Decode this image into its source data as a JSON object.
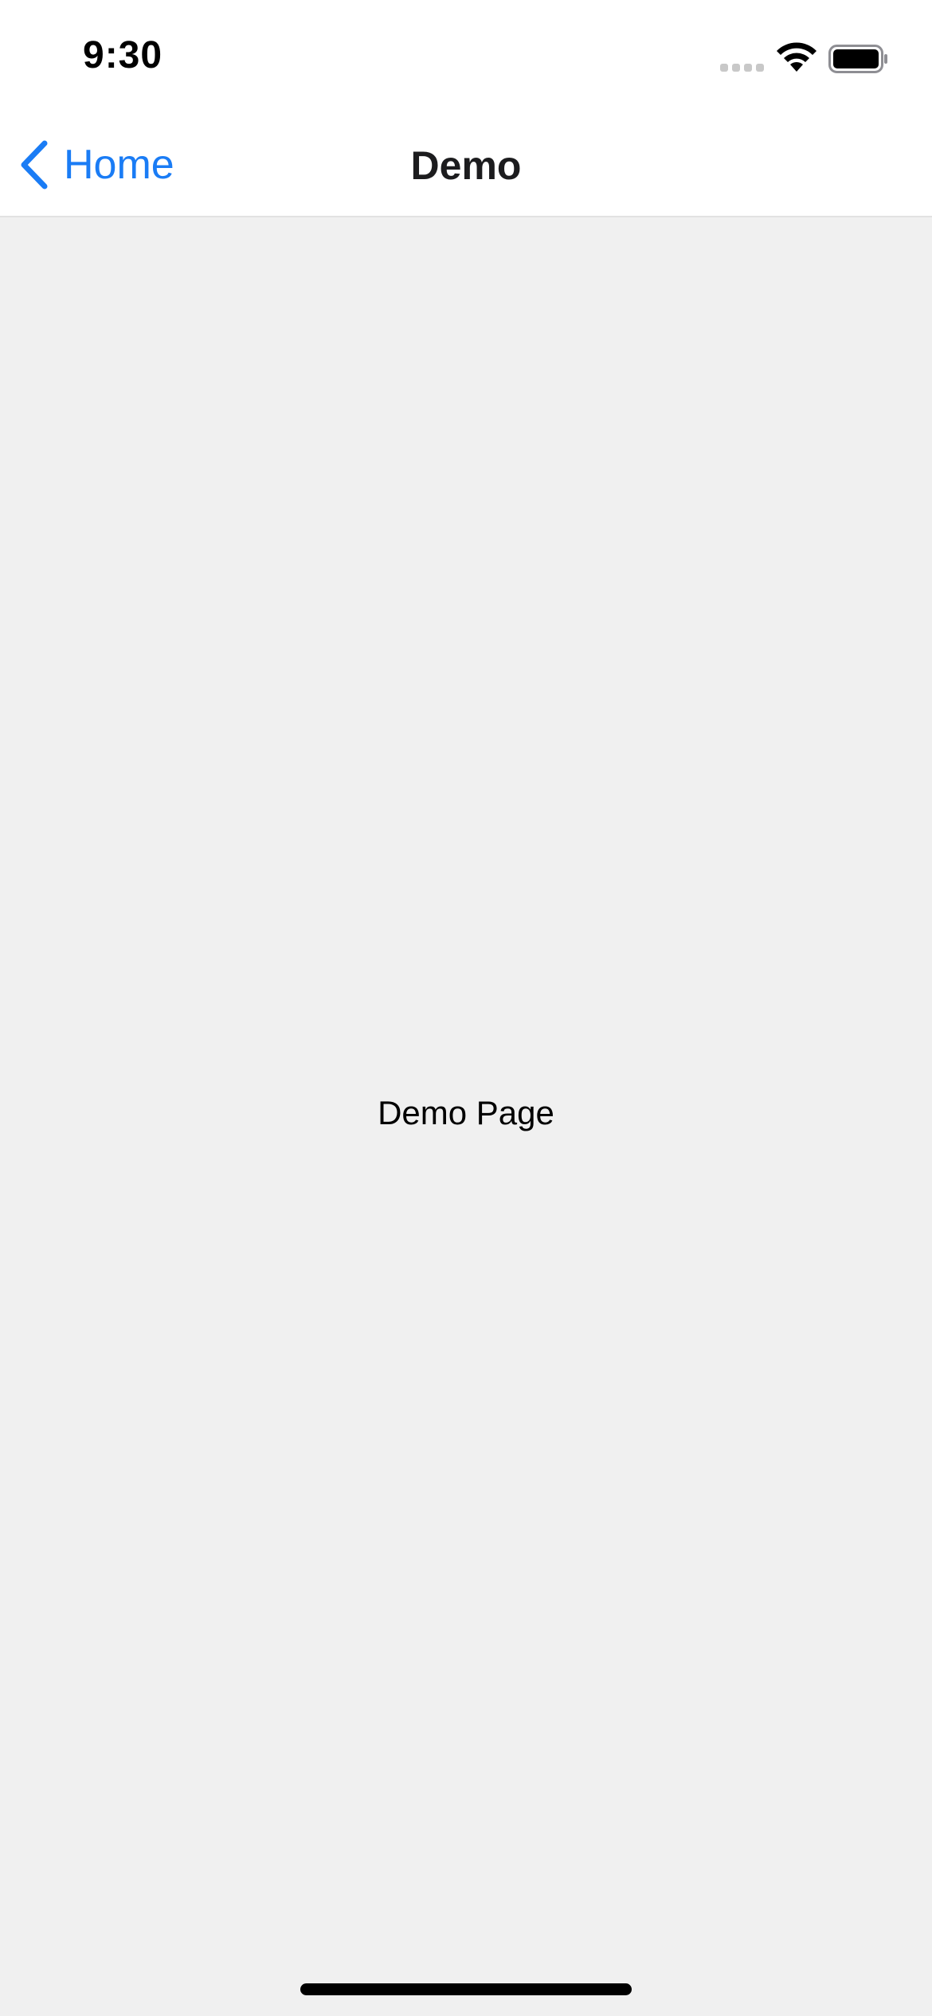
{
  "status_bar": {
    "time": "9:30",
    "signal_icon": "cellular-signal-icon",
    "wifi_icon": "wifi-icon",
    "battery_icon": "battery-icon"
  },
  "nav_bar": {
    "back_label": "Home",
    "back_icon": "chevron-left-icon",
    "title": "Demo"
  },
  "content": {
    "text": "Demo Page"
  },
  "colors": {
    "accent": "#1a7cf5",
    "nav_background": "#ffffff",
    "content_background": "#f0f0f0",
    "text": "#000000"
  }
}
